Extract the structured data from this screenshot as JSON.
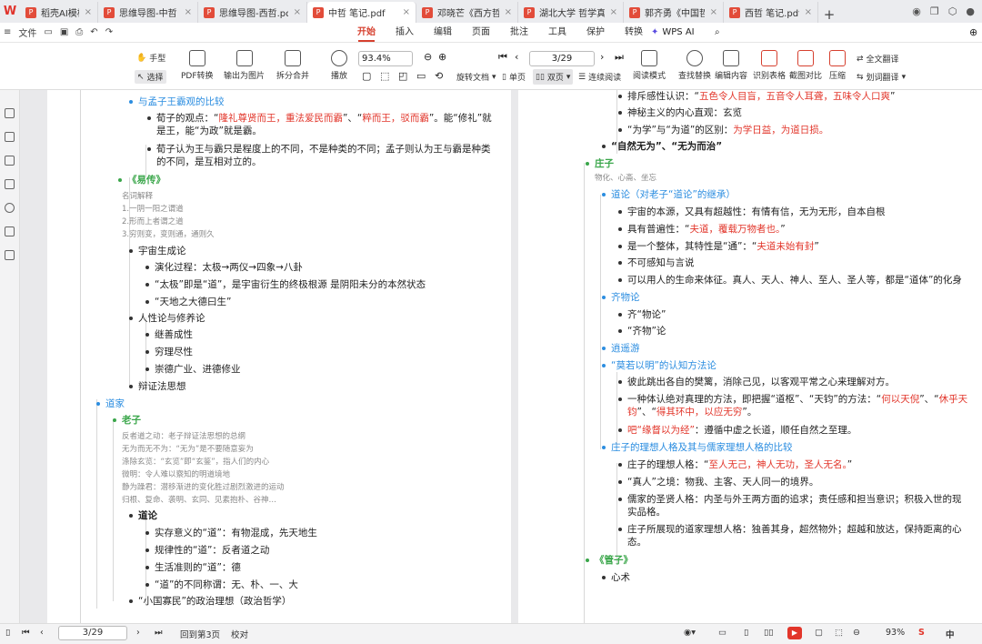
{
  "tabs": [
    {
      "label": "稻壳AI模板",
      "active": false
    },
    {
      "label": "思维导图-中哲",
      "active": false
    },
    {
      "label": "思维导图-西哲.pdf（已",
      "active": false
    },
    {
      "label": "中哲 笔记.pdf",
      "active": true
    },
    {
      "label": "邓晓芒《西方哲学史》",
      "active": false
    },
    {
      "label": "湖北大学 哲学真题200",
      "active": false
    },
    {
      "label": "郭齐勇《中国哲学史》",
      "active": false
    },
    {
      "label": "西哲 笔记.pdf",
      "active": false
    }
  ],
  "menu": {
    "file": "文件",
    "items": [
      "开始",
      "插入",
      "编辑",
      "页面",
      "批注",
      "工具",
      "保护",
      "转换"
    ],
    "active": "开始",
    "wps_ai": "WPS AI"
  },
  "ribbon": {
    "hand": "手型",
    "select": "选择",
    "pdf_convert": "PDF转换",
    "export_image": "输出为图片",
    "split_merge": "拆分合并",
    "play": "播放",
    "zoom": "93.4%",
    "page": "3/29",
    "rotate": "旋转文档",
    "single": "单页",
    "double": "双页",
    "continuous": "连续阅读",
    "read_mode": "阅读模式",
    "find_replace": "查找替换",
    "edit_content": "编辑内容",
    "recognize_table": "识别表格",
    "screenshot_compare": "截图对比",
    "compress": "压缩",
    "translate_full": "全文翻译",
    "translate_select": "划词翻译"
  },
  "left_page": [
    {
      "t": "与孟子王霸观的比较",
      "c": "h"
    },
    {
      "p": [
        {
          "t": "荀子的观点：“"
        },
        {
          "t": "隆礼尊贤而王，重法爱民而霸",
          "r": 1
        },
        {
          "t": "”、“"
        },
        {
          "t": "粹而王，驳而霸",
          "r": 1
        },
        {
          "t": "”。能“修礼”就"
        }
      ]
    },
    {
      "t": "是王，能“为政”就是霸。"
    },
    {
      "t": "荀子认为王与霸只是程度上的不同，不是种类的不同；孟子则认为王与霸是种类"
    },
    {
      "t": "的不同，是互相对立的。"
    },
    {
      "t": "《易传》",
      "c": "g"
    },
    {
      "t": "名词解释",
      "c": "sm"
    },
    {
      "t": "1.一阴一阳之谓道",
      "c": "sm"
    },
    {
      "t": "2.形而上者谓之道",
      "c": "sm"
    },
    {
      "t": "3.穷则变，变则通，通则久",
      "c": "sm"
    },
    {
      "t": "宇宙生成论"
    },
    {
      "t": "演化过程：太极→两仪→四象→八卦"
    },
    {
      "t": "“太极”即是“道”，是宇宙衍生的终极根源 是阴阳未分的本然状态"
    },
    {
      "t": "“天地之大德曰生”"
    },
    {
      "t": "人性论与修养论"
    },
    {
      "t": "继善成性"
    },
    {
      "t": "穷理尽性"
    },
    {
      "t": "崇德广业、进德修业"
    },
    {
      "t": "辩证法思想"
    },
    {
      "t": "道家",
      "c": "h"
    },
    {
      "t": "老子",
      "c": "g"
    },
    {
      "t": "反者道之动：老子辩证法思想的总纲",
      "c": "sm"
    },
    {
      "t": "无为而无不为：“无为”是不要随意妄为",
      "c": "sm"
    },
    {
      "t": "涤除玄览：“玄览”即“玄鉴”，指人们的内心",
      "c": "sm"
    },
    {
      "t": "微明：令人难以察知的明道境地",
      "c": "sm"
    },
    {
      "t": "静为躁君：潜移渐进的变化胜过剧烈激进的运动",
      "c": "sm"
    },
    {
      "t": "归根、复命、袭明、玄同、见素抱朴、谷神…",
      "c": "sm"
    },
    {
      "t": "道论",
      "c": "b"
    },
    {
      "t": "实存意义的“道”：有物混成，先天地生"
    },
    {
      "t": "规律性的“道”：反者道之动"
    },
    {
      "t": "生活准则的“道”：德"
    },
    {
      "t": "“道”的不同称谓：无、朴、一、大"
    },
    {
      "t": "“小国寡民”的政治理想（政治哲学）"
    }
  ],
  "right_page": [
    {
      "p": [
        {
          "t": "排斥感性认识：“"
        },
        {
          "t": "五色令人目盲，五音令人耳聋，五味令人口爽",
          "r": 1
        },
        {
          "t": "”"
        }
      ]
    },
    {
      "t": "神秘主义的内心直观：玄览"
    },
    {
      "p": [
        {
          "t": "“为学”与“为道”的区别："
        },
        {
          "t": "为学日益，为道日损。",
          "r": 1
        }
      ]
    },
    {
      "t": "“自然无为”、“无为而治”",
      "c": "b"
    },
    {
      "t": "庄子",
      "c": "g"
    },
    {
      "t": "物化、心斋、坐忘",
      "c": "sm"
    },
    {
      "t": "道论（对老子“道论”的继承）",
      "c": "h"
    },
    {
      "t": "宇宙的本源，又具有超越性：有情有信，无为无形，自本自根"
    },
    {
      "p": [
        {
          "t": "具有普遍性：“"
        },
        {
          "t": "夫道，覆载万物者也。",
          "r": 1
        },
        {
          "t": "”"
        }
      ]
    },
    {
      "p": [
        {
          "t": "是一个整体，其特性是“通”：“"
        },
        {
          "t": "夫道未始有封",
          "r": 1
        },
        {
          "t": "”"
        }
      ]
    },
    {
      "t": "不可感知与言说"
    },
    {
      "t": "可以用人的生命来体征。真人、天人、神人、至人、圣人等，都是“道体”的化身"
    },
    {
      "t": "齐物论",
      "c": "h"
    },
    {
      "t": "齐“物论”"
    },
    {
      "t": "“齐物”论"
    },
    {
      "t": "逍遥游",
      "c": "h"
    },
    {
      "t": "“莫若以明”的认知方法论",
      "c": "h"
    },
    {
      "t": "彼此跳出各自的樊篱，消除己见，以客观平常之心来理解对方。"
    },
    {
      "p": [
        {
          "t": "一种体认绝对真理的方法，即把握“道枢”、“天钧”的方法：“"
        },
        {
          "t": "何以天倪",
          "r": 1
        },
        {
          "t": "”、“"
        },
        {
          "t": "休乎天",
          "r": 1
        }
      ]
    },
    {
      "p": [
        {
          "t": "钧",
          "r": 1
        },
        {
          "t": "”、“"
        },
        {
          "t": "得其环中，以应无穷",
          "r": 1
        },
        {
          "t": "”。"
        }
      ]
    },
    {
      "p": [
        {
          "t": "吧“缘督以为经”",
          "r": 1
        },
        {
          "t": "：遵循中虚之长道，顺任自然之至理。"
        }
      ]
    },
    {
      "t": "庄子的理想人格及其与儒家理想人格的比较",
      "c": "h"
    },
    {
      "p": [
        {
          "t": "庄子的理想人格：“"
        },
        {
          "t": "至人无己，神人无功，圣人无名。",
          "r": 1
        },
        {
          "t": "”"
        }
      ]
    },
    {
      "t": "“真人”之境：物我、主客、天人同一的境界。"
    },
    {
      "t": "儒家的圣贤人格：内圣与外王两方面的追求；责任感和担当意识；积极入世的现"
    },
    {
      "t": "实品格。"
    },
    {
      "t": "庄子所展现的道家理想人格：独善其身，超然物外；超越和放达，保持距离的心"
    },
    {
      "t": "态。"
    },
    {
      "t": "《管子》",
      "c": "g"
    },
    {
      "t": "心术"
    }
  ],
  "status": {
    "page": "3/29",
    "back": "回到第3页",
    "proof": "校对",
    "zoom": "93%",
    "ime": "中"
  }
}
